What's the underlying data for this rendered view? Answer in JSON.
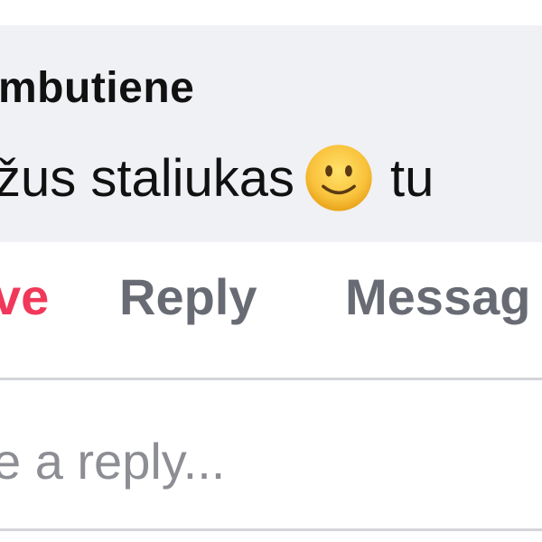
{
  "comment": {
    "author": "mbutiene",
    "text": "žus staliukas",
    "text_after": "tu",
    "emoji": "slightly-smiling-face-icon"
  },
  "actions": {
    "love_label": "ve",
    "reply_label": "Reply",
    "message_label": "Messag"
  },
  "reply_box": {
    "placeholder": "e a reply..."
  },
  "colors": {
    "bubble_bg": "#f0f1f5",
    "love": "#f0385a",
    "action": "#686b73",
    "divider": "#d4d5d9",
    "placeholder": "#8c8e94"
  }
}
